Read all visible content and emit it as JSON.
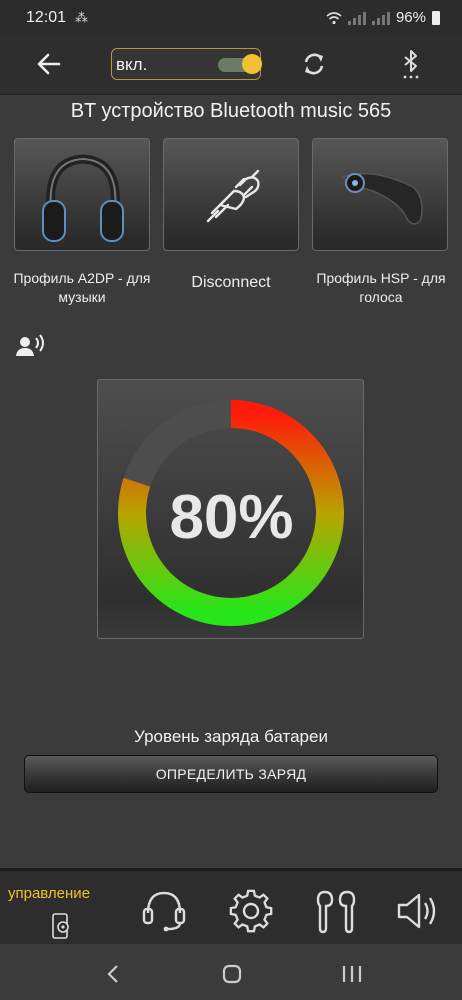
{
  "status_bar": {
    "time": "12:01",
    "battery_percent": "96%"
  },
  "toolbar": {
    "toggle_label": "вкл.",
    "toggle_on": true,
    "accent_color": "#f2c034"
  },
  "device": {
    "title": "BT устройство Bluetooth music 565"
  },
  "profiles": [
    {
      "label": "Профиль A2DP - для музыки",
      "icon": "headphones-icon"
    },
    {
      "label": "Disconnect",
      "icon": "plug-icon"
    },
    {
      "label": "Профиль HSP - для голоса",
      "icon": "headset-icon"
    }
  ],
  "battery": {
    "level": 80,
    "level_text": "80%",
    "label": "Уровень заряда батареи",
    "detect_button": "ОПРЕДЕЛИТЬ ЗАРЯД"
  },
  "bottom_nav": {
    "active_label": "управление",
    "active_color": "#f2c22f"
  }
}
